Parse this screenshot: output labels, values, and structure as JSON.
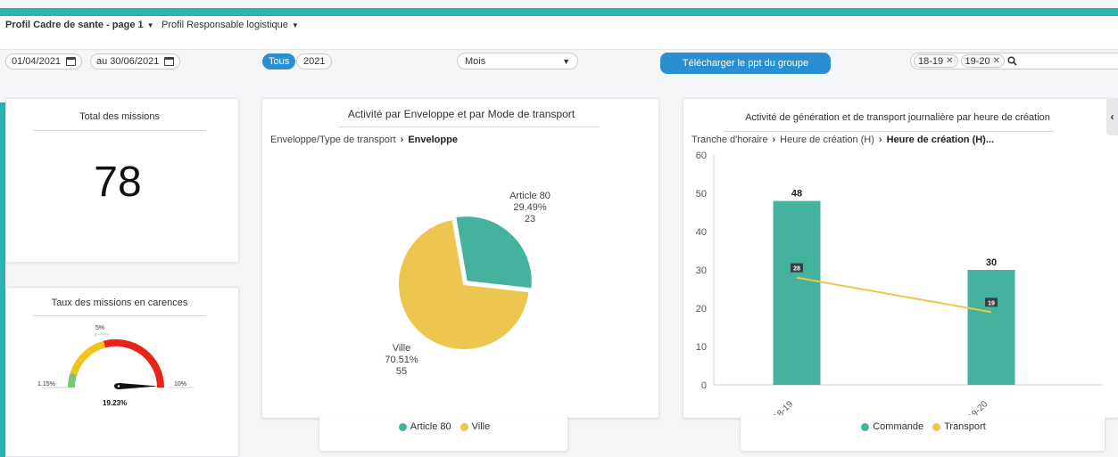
{
  "tabs": [
    {
      "label": "Profil Cadre de sante - page 1",
      "active": true
    },
    {
      "label": "Profil Responsable logistique",
      "active": false
    }
  ],
  "toolbar": {
    "date_from": "01/04/2021",
    "date_to": "au 30/06/2021",
    "period_all": "Tous",
    "period_year": "2021",
    "granularity": "Mois",
    "download_label": "Télécharger le ppt du groupe",
    "filter_tags": [
      "18-19",
      "19-20"
    ]
  },
  "total_missions": {
    "title": "Total des missions",
    "value": "78"
  },
  "gauge": {
    "title": "Taux des missions en carences",
    "min_label": "1.15%",
    "mid_label": "5%",
    "max_label": "10%",
    "value_label": "19.23%",
    "value": 19.23,
    "colors": [
      "#7cc576",
      "#f0c419",
      "#e8231b"
    ]
  },
  "pie_card": {
    "title": "Activité par Enveloppe et par Mode de transport",
    "crumb_root": "Enveloppe/Type de transport",
    "crumb_current": "Enveloppe",
    "legend": [
      {
        "label": "Article 80",
        "color": "#45b29d"
      },
      {
        "label": "Ville",
        "color": "#ecc64f"
      }
    ]
  },
  "bar_card": {
    "title": "Activité de génération et de transport journalière par heure de création",
    "crumbs": [
      "Tranche d'horaire",
      "Heure de création (H)"
    ],
    "crumb_current": "Heure de création (H)...",
    "legend": [
      {
        "label": "Commande",
        "color": "#45b29d"
      },
      {
        "label": "Transport",
        "color": "#ecc64f"
      }
    ]
  },
  "chart_data": [
    {
      "type": "pie",
      "categories": [
        "Article 80",
        "Ville"
      ],
      "values": [
        23,
        55
      ],
      "percent_labels": [
        "29.49%",
        "70.51%"
      ],
      "colors": [
        "#45b29d",
        "#ecc64f"
      ]
    },
    {
      "type": "bar",
      "categories": [
        "18-19",
        "19-20"
      ],
      "ylim": [
        0,
        60
      ],
      "yticks": [
        "0",
        "10",
        "20",
        "30",
        "40",
        "50",
        "60"
      ],
      "series": [
        {
          "name": "Commande",
          "type": "bar",
          "values": [
            48,
            30
          ],
          "color": "#45b29d"
        },
        {
          "name": "Transport",
          "type": "line",
          "values": [
            28,
            19
          ],
          "color": "#ecc64f"
        }
      ]
    }
  ]
}
